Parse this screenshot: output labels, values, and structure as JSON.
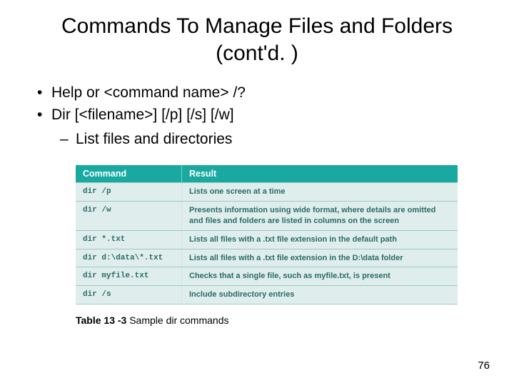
{
  "title": "Commands To Manage Files and Folders (cont'd. )",
  "bullets": [
    "Help or <command name> /?",
    "Dir [<filename>] [/p] [/s] [/w]"
  ],
  "sub_bullet": "List files and directories",
  "table": {
    "headers": [
      "Command",
      "Result"
    ],
    "rows": [
      {
        "cmd": "dir /p",
        "result": "Lists one screen at a time"
      },
      {
        "cmd": "dir /w",
        "result": "Presents information using wide format, where details are omitted and files and folders are listed in columns on the screen"
      },
      {
        "cmd": "dir *.txt",
        "result": "Lists all files with a .txt file extension in the default path"
      },
      {
        "cmd": "dir d:\\data\\*.txt",
        "result": "Lists all files with a .txt file extension in the D:\\data folder"
      },
      {
        "cmd": "dir myfile.txt",
        "result": "Checks that a single file, such as myfile.txt, is present"
      },
      {
        "cmd": "dir /s",
        "result": "Include subdirectory entries"
      }
    ]
  },
  "caption_label": "Table 13 -3",
  "caption_text": " Sample dir commands",
  "page_number": "76"
}
